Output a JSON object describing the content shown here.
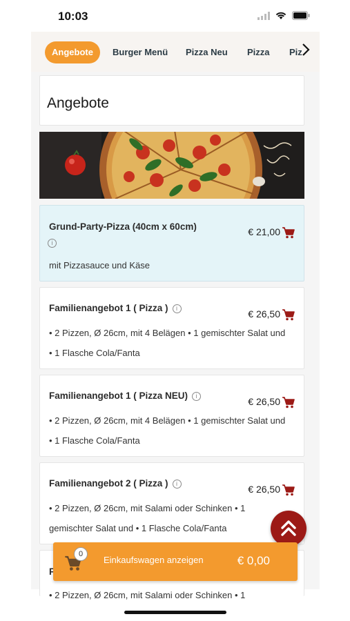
{
  "status_bar": {
    "time": "10:03"
  },
  "tabs": [
    "Angebote",
    "Burger Menü",
    "Pizza Neu",
    "Pizza",
    "Piz"
  ],
  "section": {
    "title": "Angebote"
  },
  "items": [
    {
      "name": "Grund-Party-Pizza (40cm x 60cm)",
      "price": "€ 21,00",
      "desc": [
        "mit Pizzasauce und Käse"
      ]
    },
    {
      "name": "Familienangebot 1 ( Pizza )",
      "price": "€ 26,50",
      "desc": [
        "• 2 Pizzen, Ø 26cm, mit 4 Belägen • 1 gemischter Salat und",
        "• 1 Flasche Cola/Fanta"
      ]
    },
    {
      "name": "Familienangebot 1 ( Pizza NEU)",
      "price": "€ 26,50",
      "desc": [
        "• 2 Pizzen, Ø 26cm, mit 4 Belägen • 1 gemischter Salat und",
        "• 1 Flasche Cola/Fanta"
      ]
    },
    {
      "name": "Familienangebot 2 ( Pizza )",
      "price": "€ 26,50",
      "desc": [
        "• 2 Pizzen, Ø 26cm, mit Salami oder Schinken • 1",
        "gemischter Salat und • 1 Flasche Cola/Fanta"
      ]
    }
  ],
  "partial_item": {
    "name_start": "F",
    "desc": "• 2 Pizzen, Ø 26cm, mit Salami oder Schinken • 1"
  },
  "cart_bar": {
    "badge": "0",
    "label": "Einkaufswagen anzeigen",
    "total": "€ 0,00"
  },
  "colors": {
    "accent": "#f39a2e",
    "cart_icon": "#9c1a16",
    "highlight": "#e4f4f8"
  },
  "icons": {
    "info": "i"
  }
}
